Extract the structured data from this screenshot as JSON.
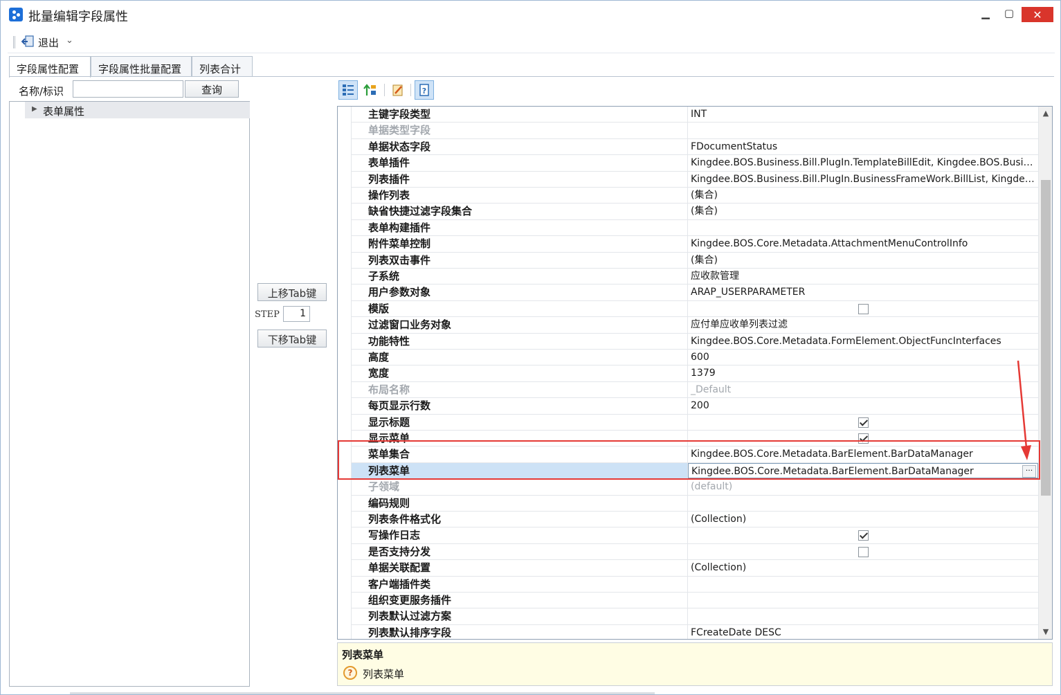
{
  "window": {
    "title": "批量编辑字段属性",
    "minimize": "▁",
    "maximize": "▢",
    "close": "✕"
  },
  "toolbar": {
    "exit_label": "退出",
    "exit_caret": "⌄"
  },
  "tabs": [
    {
      "label": "字段属性配置",
      "active": true
    },
    {
      "label": "字段属性批量配置",
      "active": false
    },
    {
      "label": "列表合计",
      "active": false
    }
  ],
  "search": {
    "label": "名称/标识",
    "value": "",
    "query_button": "查询"
  },
  "tree": {
    "root_label": "表单属性"
  },
  "mover": {
    "up_label": "上移Tab键",
    "step_label": "STEP",
    "step_value": "1",
    "down_label": "下移Tab键"
  },
  "property_grid": {
    "rows": [
      {
        "name": "主键字段类型",
        "value": "INT",
        "type": "text"
      },
      {
        "name": "单据类型字段",
        "value": "",
        "type": "text",
        "disabled": true
      },
      {
        "name": "单据状态字段",
        "value": "FDocumentStatus",
        "type": "text"
      },
      {
        "name": "表单插件",
        "value": "Kingdee.BOS.Business.Bill.PlugIn.TemplateBillEdit, Kingdee.BOS.Busine...",
        "type": "text"
      },
      {
        "name": "列表插件",
        "value": "Kingdee.BOS.Business.Bill.PlugIn.BusinessFrameWork.BillList, Kingdee....",
        "type": "text"
      },
      {
        "name": "操作列表",
        "value": "(集合)",
        "type": "text"
      },
      {
        "name": "缺省快捷过滤字段集合",
        "value": "(集合)",
        "type": "text"
      },
      {
        "name": "表单构建插件",
        "value": "",
        "type": "text"
      },
      {
        "name": "附件菜单控制",
        "value": "Kingdee.BOS.Core.Metadata.AttachmentMenuControlInfo",
        "type": "text"
      },
      {
        "name": "列表双击事件",
        "value": "(集合)",
        "type": "text"
      },
      {
        "name": "子系统",
        "value": "应收款管理",
        "type": "text"
      },
      {
        "name": "用户参数对象",
        "value": "ARAP_USERPARAMETER",
        "type": "text"
      },
      {
        "name": "模版",
        "value": "",
        "type": "checkbox",
        "checked": false
      },
      {
        "name": "过滤窗口业务对象",
        "value": "应付单应收单列表过滤",
        "type": "text"
      },
      {
        "name": "功能特性",
        "value": "Kingdee.BOS.Core.Metadata.FormElement.ObjectFuncInterfaces",
        "type": "text"
      },
      {
        "name": "高度",
        "value": "600",
        "type": "text"
      },
      {
        "name": "宽度",
        "value": "1379",
        "type": "text"
      },
      {
        "name": "布局名称",
        "value": "_Default",
        "type": "text",
        "disabled": true
      },
      {
        "name": "每页显示行数",
        "value": "200",
        "type": "text"
      },
      {
        "name": "显示标题",
        "value": "",
        "type": "checkbox",
        "checked": true
      },
      {
        "name": "显示菜单",
        "value": "",
        "type": "checkbox",
        "checked": true
      },
      {
        "name": "菜单集合",
        "value": "Kingdee.BOS.Core.Metadata.BarElement.BarDataManager",
        "type": "text"
      },
      {
        "name": "列表菜单",
        "value": "Kingdee.BOS.Core.Metadata.BarElement.BarDataManager",
        "type": "text",
        "selected": true,
        "ellipsis": "···"
      },
      {
        "name": "子领域",
        "value": "(default)",
        "type": "text",
        "disabled": true
      },
      {
        "name": "编码规则",
        "value": "",
        "type": "text"
      },
      {
        "name": "列表条件格式化",
        "value": "(Collection)",
        "type": "text"
      },
      {
        "name": "写操作日志",
        "value": "",
        "type": "checkbox",
        "checked": true
      },
      {
        "name": "是否支持分发",
        "value": "",
        "type": "checkbox",
        "checked": false
      },
      {
        "name": "单据关联配置",
        "value": "(Collection)",
        "type": "text"
      },
      {
        "name": "客户端插件类",
        "value": "",
        "type": "text"
      },
      {
        "name": "组织变更服务插件",
        "value": "",
        "type": "text"
      },
      {
        "name": "列表默认过滤方案",
        "value": "",
        "type": "text"
      },
      {
        "name": "列表默认排序字段",
        "value": "FCreateDate DESC",
        "type": "text"
      }
    ]
  },
  "description": {
    "title": "列表菜单",
    "text": "列表菜单"
  },
  "colors": {
    "annotation_red": "#e53935",
    "selected_row": "#cde2f6",
    "description_bg": "#fffde4"
  }
}
